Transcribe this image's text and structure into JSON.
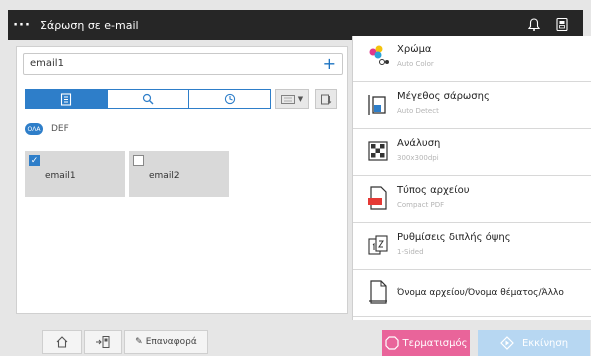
{
  "header": {
    "title": "Σάρωση σε e-mail",
    "menu_glyph": "···",
    "icons": [
      "bell-icon",
      "network-icon"
    ]
  },
  "address": {
    "value": "email1",
    "add_glyph": "+"
  },
  "tabs": [
    {
      "name": "address-book-icon",
      "active": true
    },
    {
      "name": "search-icon",
      "active": false
    },
    {
      "name": "history-icon",
      "active": false
    }
  ],
  "filter": {
    "pill": "ΟΛΑ",
    "label": "DEF"
  },
  "destinations": [
    {
      "label": "email1",
      "checked": true
    },
    {
      "label": "email2",
      "checked": false
    }
  ],
  "settings": [
    {
      "title": "Χρώμα",
      "value": "Auto Color",
      "icon": "color-icon"
    },
    {
      "title": "Μέγεθος σάρωσης",
      "value": "Auto Detect",
      "icon": "scan-size-icon"
    },
    {
      "title": "Ανάλυση",
      "value": "300x300dpi",
      "icon": "resolution-icon"
    },
    {
      "title": "Τύπος αρχείου",
      "value": "Compact PDF",
      "icon": "file-type-icon"
    },
    {
      "title": "Ρυθμίσεις διπλής όψης",
      "value": "1-Sided",
      "icon": "duplex-icon"
    },
    {
      "title": "Όνομα αρχείου/Όνομα θέματος/Άλλο",
      "value": "",
      "icon": "filename-icon"
    }
  ],
  "bottom": {
    "reset_label": "Επαναφορά",
    "stop_label": "Τερματισμός",
    "start_label": "Εκκίνηση"
  },
  "colors": {
    "accent": "#2e7ec9",
    "stop": "#e9649a",
    "start_disabled": "#b7d7f2",
    "header": "#262626"
  }
}
